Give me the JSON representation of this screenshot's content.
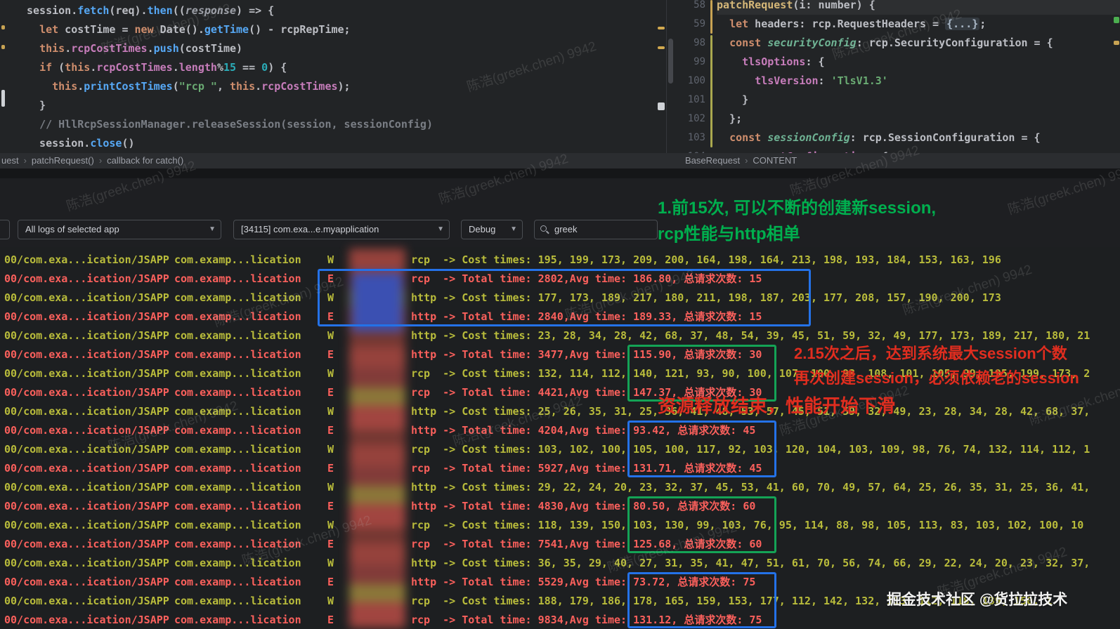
{
  "editor": {
    "left": {
      "lines": [
        {
          "tokens": [
            [
              "pl",
              "session."
            ],
            [
              "fn",
              "fetch"
            ],
            [
              "pl",
              "(req)."
            ],
            [
              "fn",
              "then"
            ],
            [
              "pl",
              "(("
            ],
            [
              "gy",
              "response"
            ],
            [
              "pl",
              ") => {"
            ]
          ]
        },
        {
          "tokens": [
            [
              "pl",
              "  "
            ],
            [
              "kw",
              "let"
            ],
            [
              "pl",
              " costTime = "
            ],
            [
              "kw",
              "new"
            ],
            [
              "pl",
              " Date()."
            ],
            [
              "fn",
              "getTime"
            ],
            [
              "pl",
              "() - rcpRepTime;"
            ]
          ]
        },
        {
          "tokens": [
            [
              "pl",
              "  "
            ],
            [
              "kw",
              "this"
            ],
            [
              "pl",
              "."
            ],
            [
              "pr",
              "rcpCostTimes"
            ],
            [
              "pl",
              "."
            ],
            [
              "fn",
              "push"
            ],
            [
              "pl",
              "(costTime)"
            ]
          ]
        },
        {
          "tokens": [
            [
              "pl",
              "  "
            ],
            [
              "kw",
              "if"
            ],
            [
              "pl",
              " ("
            ],
            [
              "kw",
              "this"
            ],
            [
              "pl",
              "."
            ],
            [
              "pr",
              "rcpCostTimes"
            ],
            [
              "pl",
              "."
            ],
            [
              "pr",
              "length"
            ],
            [
              "pl",
              "%"
            ],
            [
              "nm",
              "15"
            ],
            [
              "pl",
              " == "
            ],
            [
              "nm",
              "0"
            ],
            [
              "pl",
              ") {"
            ]
          ]
        },
        {
          "tokens": [
            [
              "pl",
              "    "
            ],
            [
              "kw",
              "this"
            ],
            [
              "pl",
              "."
            ],
            [
              "fn",
              "printCostTimes"
            ],
            [
              "pl",
              "("
            ],
            [
              "st",
              "\"rcp \""
            ],
            [
              "pl",
              ", "
            ],
            [
              "kw",
              "this"
            ],
            [
              "pl",
              "."
            ],
            [
              "pr",
              "rcpCostTimes"
            ],
            [
              "pl",
              ");"
            ]
          ]
        },
        {
          "tokens": [
            [
              "pl",
              "  }"
            ]
          ]
        },
        {
          "tokens": [
            [
              "pl",
              "  "
            ],
            [
              "cm",
              "// HllRcpSessionManager.releaseSession(session, sessionConfig)"
            ]
          ]
        },
        {
          "tokens": [
            [
              "pl",
              "  session."
            ],
            [
              "fn",
              "close"
            ],
            [
              "pl",
              "()"
            ]
          ]
        }
      ]
    },
    "right": {
      "lines": [
        {
          "num": "58",
          "sticky": true,
          "tokens": [
            [
              "fnd",
              "patchRequest"
            ],
            [
              "pl",
              "(i: number) {"
            ]
          ]
        },
        {
          "num": "59",
          "tokens": [
            [
              "pl",
              "  "
            ],
            [
              "kw",
              "let"
            ],
            [
              "pl",
              " headers: rcp.RequestHeaders = "
            ],
            [
              "fold",
              "{...}"
            ],
            [
              "pl",
              ";"
            ]
          ]
        },
        {
          "num": "98",
          "tokens": [
            [
              "pl",
              "  "
            ],
            [
              "kw",
              "const"
            ],
            [
              "pl",
              " "
            ],
            [
              "cst",
              "securityConfig"
            ],
            [
              "pl",
              ": rcp.SecurityConfiguration = {"
            ]
          ]
        },
        {
          "num": "99",
          "tokens": [
            [
              "pl",
              "    "
            ],
            [
              "pr",
              "tlsOptions"
            ],
            [
              "pl",
              ": {"
            ]
          ]
        },
        {
          "num": "100",
          "tokens": [
            [
              "pl",
              "      "
            ],
            [
              "pr",
              "tlsVersion"
            ],
            [
              "pl",
              ": "
            ],
            [
              "st",
              "'TlsV1.3'"
            ]
          ]
        },
        {
          "num": "101",
          "tokens": [
            [
              "pl",
              "    }"
            ]
          ]
        },
        {
          "num": "102",
          "tokens": [
            [
              "pl",
              "  };"
            ]
          ]
        },
        {
          "num": "103",
          "tokens": [
            [
              "pl",
              "  "
            ],
            [
              "kw",
              "const"
            ],
            [
              "pl",
              " "
            ],
            [
              "cst",
              "sessionConfig"
            ],
            [
              "pl",
              ": rcp.SessionConfiguration = {"
            ]
          ]
        },
        {
          "num": "104",
          "tokens": [
            [
              "pl",
              "    "
            ],
            [
              "pr",
              "requestConfiguration"
            ],
            [
              "pl",
              ": {"
            ]
          ]
        }
      ]
    }
  },
  "breadcrumb": {
    "left": [
      "uest",
      "patchRequest()",
      "callback for catch()"
    ],
    "right": [
      "BaseRequest",
      "CONTENT"
    ]
  },
  "logcat": {
    "app_filter": "All logs of selected app",
    "process": "[34115] com.exa...e.myapplication",
    "level": "Debug",
    "search_query": "greek"
  },
  "annotations": {
    "green_line1": "1.前15次, 可以不断的创建新session,",
    "green_line2": "rcp性能与http相单",
    "red_line1": "2.15次之后，达到系统最大session个数",
    "red_line2": "再次创建session，必须依赖老的session",
    "red_line3": "资源释放结束，性能开始下滑"
  },
  "logs": {
    "tag": "00/com.exa...ication/JSAPP",
    "pkg": "com.examp...lication",
    "rows": [
      {
        "level": "W",
        "msg": "rcp  -> Cost times: 195, 199, 173, 209, 200, 164, 198, 164, 213, 198, 193, 184, 153, 163, 196"
      },
      {
        "level": "E",
        "msg": "rcp  -> Total time: 2802,Avg time: 186.80, 总请求次数: 15"
      },
      {
        "level": "W",
        "msg": "http -> Cost times: 177, 173, 189, 217, 180, 211, 198, 187, 203, 177, 208, 157, 190, 200, 173"
      },
      {
        "level": "E",
        "msg": "http -> Total time: 2840,Avg time: 189.33, 总请求次数: 15"
      },
      {
        "level": "W",
        "msg": "http -> Cost times: 23, 28, 34, 28, 42, 68, 37, 48, 54, 39, 45, 51, 59, 32, 49, 177, 173, 189, 217, 180, 21"
      },
      {
        "level": "E",
        "msg": "http -> Total time: 3477,Avg time: 115.90, 总请求次数: 30"
      },
      {
        "level": "W",
        "msg": "rcp  -> Cost times: 132, 114, 112, 140, 121, 93, 90, 100, 107, 100, 93, 108, 101, 105, 99, 195, 199, 173, 2"
      },
      {
        "level": "E",
        "msg": "rcp  -> Total time: 4421,Avg time: 147.37, 总请求次数: 30"
      },
      {
        "level": "W",
        "msg": "http -> Cost times: 25, 26, 35, 31, 25, 36, 41, 48, 53, 57, 45, 51, 59, 32, 49, 23, 28, 34, 28, 42, 68, 37,"
      },
      {
        "level": "E",
        "msg": "http -> Total time: 4204,Avg time: 93.42, 总请求次数: 45"
      },
      {
        "level": "W",
        "msg": "rcp  -> Cost times: 103, 102, 100, 105, 100, 117, 92, 103, 120, 104, 103, 109, 98, 76, 74, 132, 114, 112, 1"
      },
      {
        "level": "E",
        "msg": "rcp  -> Total time: 5927,Avg time: 131.71, 总请求次数: 45"
      },
      {
        "level": "W",
        "msg": "http -> Cost times: 29, 22, 24, 20, 23, 32, 37, 45, 53, 41, 60, 70, 49, 57, 64, 25, 26, 35, 31, 25, 36, 41,"
      },
      {
        "level": "E",
        "msg": "http -> Total time: 4830,Avg time: 80.50, 总请求次数: 60"
      },
      {
        "level": "W",
        "msg": "rcp  -> Cost times: 118, 139, 150, 103, 130, 99, 103, 76, 95, 114, 88, 98, 105, 113, 83, 103, 102, 100, 10"
      },
      {
        "level": "E",
        "msg": "rcp  -> Total time: 7541,Avg time: 125.68, 总请求次数: 60"
      },
      {
        "level": "W",
        "msg": "http -> Cost times: 36, 35, 29, 40, 27, 31, 35, 41, 47, 51, 61, 70, 56, 74, 66, 29, 22, 24, 20, 23, 32, 37,"
      },
      {
        "level": "E",
        "msg": "http -> Total time: 5529,Avg time: 73.72, 总请求次数: 75"
      },
      {
        "level": "W",
        "msg": "rcp  -> Cost times: 188, 179, 186, 178, 165, 159, 153, 177, 112, 142, 132, 113, 112, 118, 139, 150, 1"
      },
      {
        "level": "E",
        "msg": "rcp  -> Total time: 9834,Avg time: 131.12, 总请求次数: 75"
      }
    ]
  },
  "watermark": {
    "text": "陈浩(greek.chen) 9942"
  },
  "footer": {
    "text": "掘金技术社区 @货拉拉技术"
  },
  "colors": {
    "box_blue": "#2472e8",
    "box_green": "#14a356",
    "note_green": "#00af4e",
    "note_red": "#e02d1f",
    "log_warn": "#b9bc3b",
    "log_error": "#fb605c"
  }
}
